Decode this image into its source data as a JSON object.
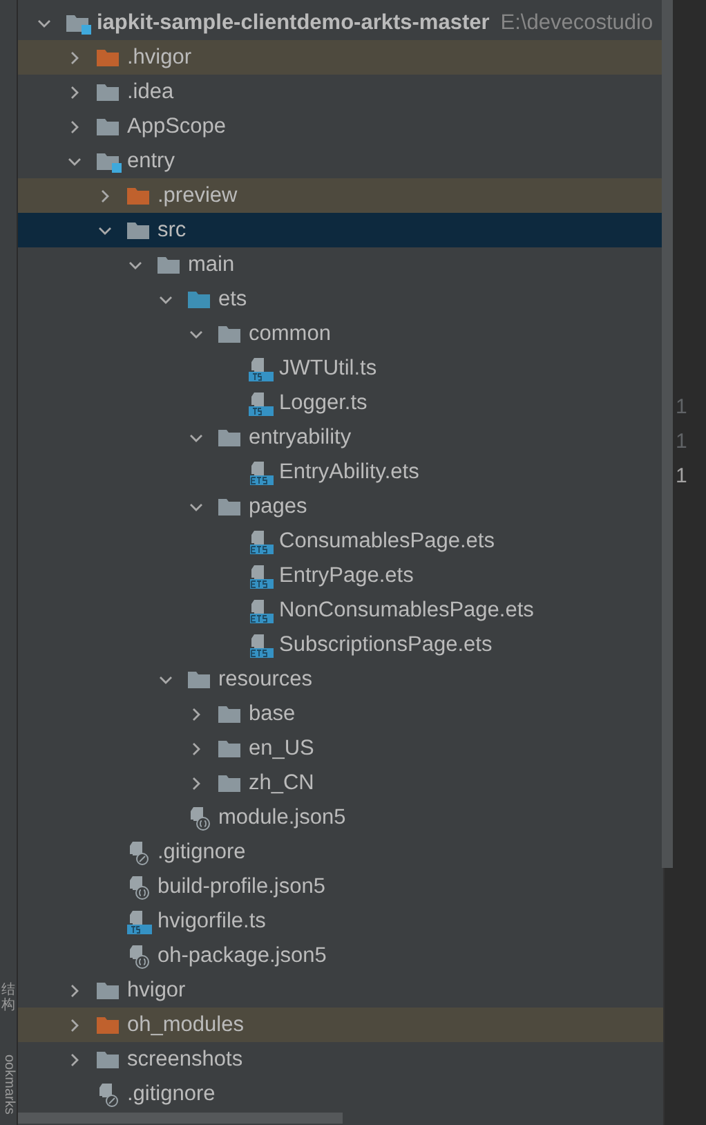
{
  "side_tabs": [
    {
      "label": "结构",
      "kind": "stacked"
    },
    {
      "label": "ookmarks",
      "kind": "rotated"
    }
  ],
  "tree": {
    "root": {
      "name": "iapkit-sample-clientdemo-arkts-master",
      "path": "E:\\devecostudio",
      "kind": "module",
      "expanded": true,
      "selected": false,
      "children": [
        {
          "name": ".hvigor",
          "kind": "excluded_folder",
          "expanded": false,
          "selected": false
        },
        {
          "name": ".idea",
          "kind": "folder",
          "expanded": false,
          "selected": false
        },
        {
          "name": "AppScope",
          "kind": "folder",
          "expanded": false,
          "selected": false
        },
        {
          "name": "entry",
          "kind": "module",
          "expanded": true,
          "selected": false,
          "children": [
            {
              "name": ".preview",
              "kind": "excluded_folder",
              "expanded": false,
              "selected": false
            },
            {
              "name": "src",
              "kind": "folder",
              "expanded": true,
              "selected": true,
              "children": [
                {
                  "name": "main",
                  "kind": "folder",
                  "expanded": true,
                  "selected": false,
                  "children": [
                    {
                      "name": "ets",
                      "kind": "source_folder",
                      "expanded": true,
                      "selected": false,
                      "children": [
                        {
                          "name": "common",
                          "kind": "folder",
                          "expanded": true,
                          "selected": false,
                          "children": [
                            {
                              "name": "JWTUtil.ts",
                              "kind": "ts_file",
                              "selected": false
                            },
                            {
                              "name": "Logger.ts",
                              "kind": "ts_file",
                              "selected": false
                            }
                          ]
                        },
                        {
                          "name": "entryability",
                          "kind": "folder",
                          "expanded": true,
                          "selected": false,
                          "children": [
                            {
                              "name": "EntryAbility.ets",
                              "kind": "ets_file",
                              "selected": false
                            }
                          ]
                        },
                        {
                          "name": "pages",
                          "kind": "folder",
                          "expanded": true,
                          "selected": false,
                          "children": [
                            {
                              "name": "ConsumablesPage.ets",
                              "kind": "ets_file",
                              "selected": false
                            },
                            {
                              "name": "EntryPage.ets",
                              "kind": "ets_file",
                              "selected": false
                            },
                            {
                              "name": "NonConsumablesPage.ets",
                              "kind": "ets_file",
                              "selected": false
                            },
                            {
                              "name": "SubscriptionsPage.ets",
                              "kind": "ets_file",
                              "selected": false
                            }
                          ]
                        }
                      ]
                    },
                    {
                      "name": "resources",
                      "kind": "folder",
                      "expanded": true,
                      "selected": false,
                      "children": [
                        {
                          "name": "base",
                          "kind": "folder",
                          "expanded": false,
                          "selected": false
                        },
                        {
                          "name": "en_US",
                          "kind": "folder",
                          "expanded": false,
                          "selected": false
                        },
                        {
                          "name": "zh_CN",
                          "kind": "folder",
                          "expanded": false,
                          "selected": false
                        }
                      ]
                    },
                    {
                      "name": "module.json5",
                      "kind": "json_file",
                      "selected": false
                    }
                  ]
                }
              ]
            },
            {
              "name": ".gitignore",
              "kind": "ignore_file",
              "selected": false
            },
            {
              "name": "build-profile.json5",
              "kind": "json_file",
              "selected": false
            },
            {
              "name": "hvigorfile.ts",
              "kind": "ts_file",
              "selected": false
            },
            {
              "name": "oh-package.json5",
              "kind": "json_file",
              "selected": false
            }
          ]
        },
        {
          "name": "hvigor",
          "kind": "folder",
          "expanded": false,
          "selected": false
        },
        {
          "name": "oh_modules",
          "kind": "excluded_folder",
          "expanded": false,
          "selected": false
        },
        {
          "name": "screenshots",
          "kind": "folder",
          "expanded": false,
          "selected": false
        },
        {
          "name": ".gitignore",
          "kind": "ignore_file",
          "selected": false
        }
      ]
    }
  },
  "gutter": {
    "line_numbers": [
      "1",
      "1",
      "1"
    ]
  }
}
